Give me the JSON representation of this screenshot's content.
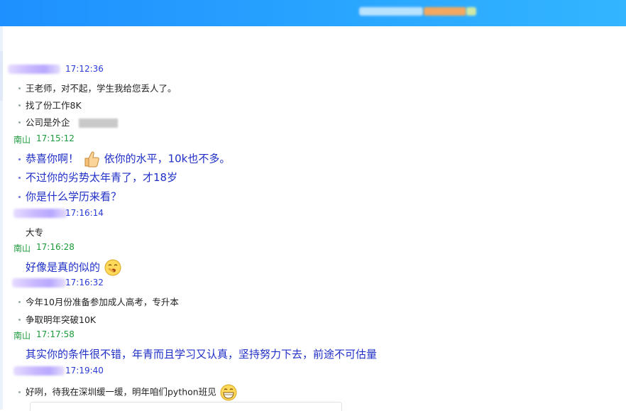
{
  "messages": [
    {
      "time": "17:12:36",
      "sender": "",
      "lines": [
        "王老师，对不起，学生我给您丢人了。",
        "找了份工作8K",
        "公司是外企"
      ]
    },
    {
      "time": "17:15:12",
      "sender": "南山",
      "lines": [
        "恭喜你啊！",
        "依你的水平，10k也不多。",
        "不过你的劣势太年青了，才18岁",
        "你是什么学历来看？"
      ]
    },
    {
      "time": "17:16:14",
      "sender": "",
      "lines": [
        "大专"
      ]
    },
    {
      "time": "17:16:28",
      "sender": "南山",
      "lines": [
        "好像是真的似的"
      ]
    },
    {
      "time": "17:16:32",
      "sender": "",
      "lines": [
        "今年10月份准备参加成人高考，专升本",
        "争取明年突破10K"
      ]
    },
    {
      "time": "17:17:58",
      "sender": "南山",
      "lines": [
        "其实你的条件很不错，年青而且学习又认真，坚持努力下去，前途不可估量"
      ]
    },
    {
      "time": "17:19:40",
      "sender": "",
      "lines": [
        "好咧，待我在深圳缓一缓，明年咱们python班见"
      ]
    }
  ],
  "icons": [
    "thumbs-up-icon",
    "yawn-emoji-icon",
    "grin-emoji-icon"
  ],
  "colors": {
    "topbar": "#1e90ff",
    "teacher_text": "#1f2fc8",
    "teacher_name": "#1a9a3a",
    "student_time": "#2a3bd8"
  }
}
